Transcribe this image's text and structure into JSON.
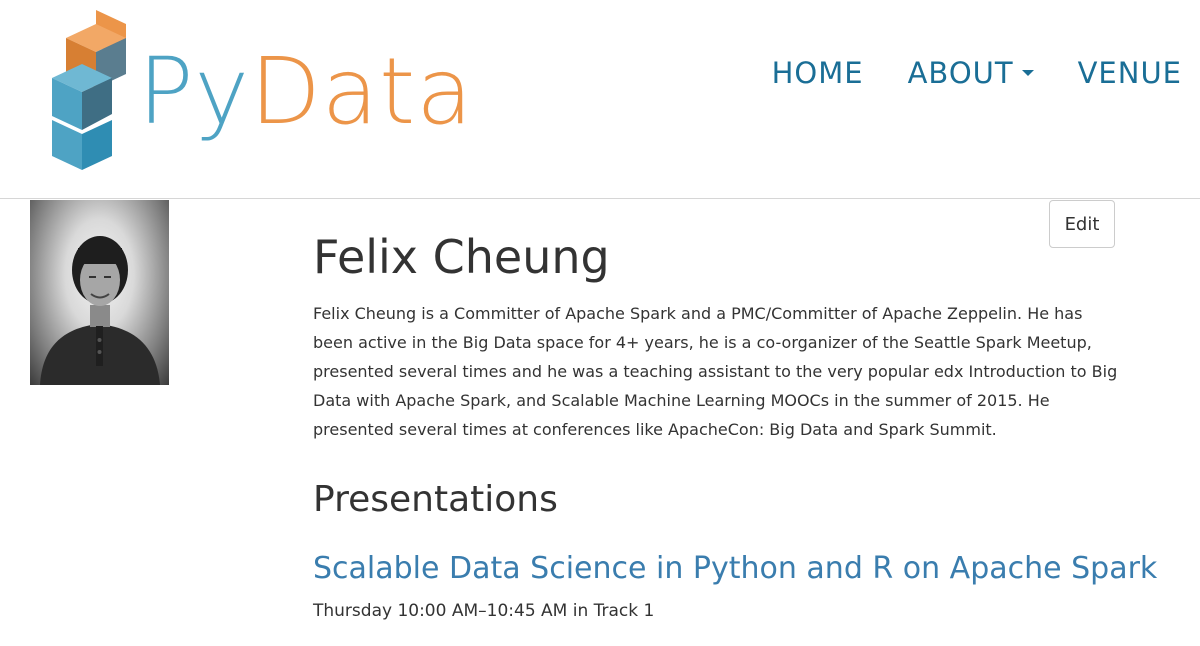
{
  "brand": {
    "py": "Py",
    "data": "Data",
    "colors": {
      "py": "#4ea3c4",
      "data": "#ec9549",
      "nav": "#1a6e96",
      "link": "#3a7dae"
    }
  },
  "nav": {
    "items": [
      {
        "label": "HOME"
      },
      {
        "label": "ABOUT",
        "dropdown": true,
        "icon": "caret-down-icon"
      },
      {
        "label": "VENUE"
      }
    ]
  },
  "speaker": {
    "name": "Felix Cheung",
    "bio": "Felix Cheung is a Committer of Apache Spark and a PMC/Committer of Apache Zeppelin. He has been active in the Big Data space for 4+ years, he is a co-organizer of the Seattle Spark Meetup, presented several times and he was a teaching assistant to the very popular edx Introduction to Big Data with Apache Spark, and Scalable Machine Learning MOOCs in the summer of 2015. He presented several times at conferences like ApacheCon: Big Data and Spark Summit."
  },
  "actions": {
    "edit_label": "Edit"
  },
  "presentations": {
    "heading": "Presentations",
    "items": [
      {
        "title": "Scalable Data Science in Python and R on Apache Spark",
        "schedule": "Thursday 10:00 AM–10:45 AM in Track 1"
      }
    ]
  }
}
